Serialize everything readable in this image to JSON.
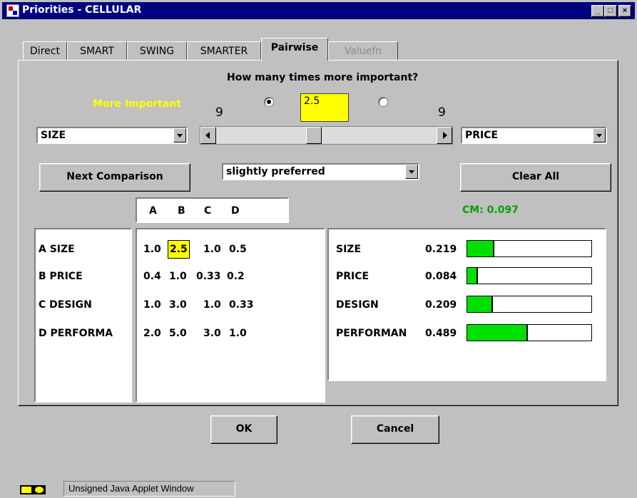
{
  "window": {
    "title": "Priorities - CELLULAR",
    "min": "_",
    "max": "□",
    "close": "×"
  },
  "tabs": [
    {
      "label": "Direct",
      "state": "normal"
    },
    {
      "label": "SMART",
      "state": "normal"
    },
    {
      "label": "SWING",
      "state": "normal"
    },
    {
      "label": "SMARTER",
      "state": "normal"
    },
    {
      "label": "Pairwise",
      "state": "active"
    },
    {
      "label": "Valuefn",
      "state": "disabled"
    }
  ],
  "comparison": {
    "question": "How many times more important?",
    "more_important_label": "More Important",
    "left_radio_checked": true,
    "right_radio_checked": false,
    "ratio_value": "2.5",
    "left_scale": "9",
    "right_scale": "9",
    "left_attribute": "SIZE",
    "right_attribute": "PRICE",
    "preference": "slightly preferred",
    "slider_position": 0.44
  },
  "buttons": {
    "next_comparison": "Next Comparison",
    "clear_all": "Clear All",
    "ok": "OK",
    "cancel": "Cancel"
  },
  "consistency": {
    "label": "CM: 0.097"
  },
  "matrix": {
    "columns": [
      "A",
      "B",
      "C",
      "D"
    ],
    "rows": [
      {
        "label": "A SIZE",
        "values": [
          "1.0",
          "2.5",
          "1.0",
          "0.5"
        ]
      },
      {
        "label": "B PRICE",
        "values": [
          "0.4",
          "1.0",
          "0.33",
          "0.2"
        ]
      },
      {
        "label": "C DESIGN",
        "values": [
          "1.0",
          "3.0",
          "1.0",
          "0.33"
        ]
      },
      {
        "label": "D PERFORMA",
        "values": [
          "2.0",
          "5.0",
          "3.0",
          "1.0"
        ]
      }
    ],
    "highlight": {
      "row": 0,
      "col": 1
    }
  },
  "weights": [
    {
      "label": "SIZE",
      "value": "0.219",
      "fraction": 0.219
    },
    {
      "label": "PRICE",
      "value": "0.084",
      "fraction": 0.084
    },
    {
      "label": "DESIGN",
      "value": "0.209",
      "fraction": 0.209
    },
    {
      "label": "PERFORMAN",
      "value": "0.489",
      "fraction": 0.489
    }
  ],
  "colors": {
    "highlight": "#ffff00",
    "bar_fill": "#00e000",
    "cm_text": "#00a000",
    "more_important": "#ffff00"
  },
  "status": {
    "text": "Unsigned Java Applet Window"
  }
}
